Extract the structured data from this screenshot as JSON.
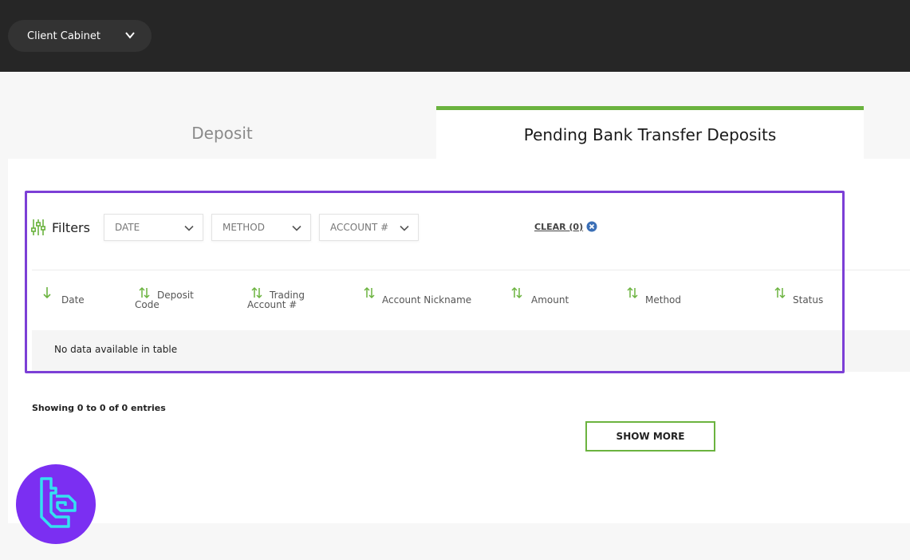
{
  "header": {
    "cabinet_label": "Client Cabinet"
  },
  "tabs": [
    {
      "label": "Deposit",
      "active": false
    },
    {
      "label": "Pending Bank Transfer Deposits",
      "active": true
    }
  ],
  "filters": {
    "label": "Filters",
    "selects": [
      {
        "value": "DATE"
      },
      {
        "value": "METHOD"
      },
      {
        "value": "ACCOUNT #"
      }
    ],
    "clear_label": "CLEAR (0)"
  },
  "table": {
    "columns": [
      {
        "line1": "Date",
        "line2": ""
      },
      {
        "line1": "Deposit",
        "line2": "Code"
      },
      {
        "line1": "Trading",
        "line2": "Account #"
      },
      {
        "line1": "Account Nickname",
        "line2": ""
      },
      {
        "line1": "Amount",
        "line2": ""
      },
      {
        "line1": "Method",
        "line2": ""
      },
      {
        "line1": "Status",
        "line2": ""
      }
    ],
    "empty_message": "No data available in table"
  },
  "footer": {
    "showing": "Showing 0 to 0 of 0 entries",
    "show_more": "SHOW MORE"
  },
  "colors": {
    "accent": "#6bb33f",
    "highlight": "#7c3fd6",
    "topbar": "#262626",
    "logo_bg": "#7b2ff2",
    "logo_fg": "#35e0f0"
  }
}
